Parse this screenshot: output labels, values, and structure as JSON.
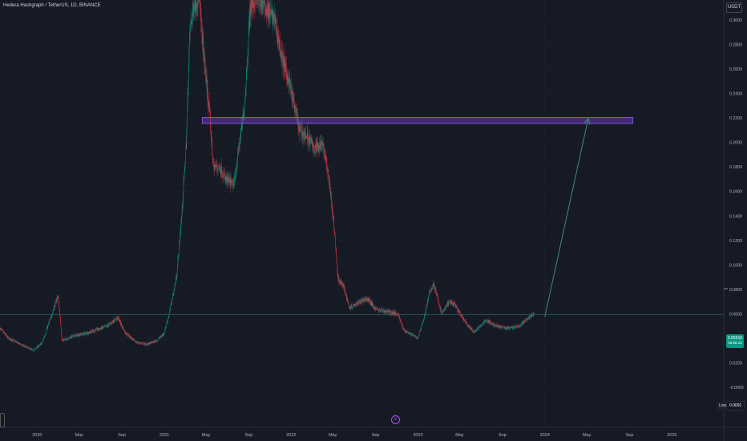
{
  "title": "Hedera Hashgraph / TetherUS, 1D, BINANCE",
  "currency": "USDT",
  "low_label": "Low",
  "low_value": "0.0091",
  "current_price": "0.05916",
  "price_countdown": "05:56:15",
  "colors": {
    "up": "#089981",
    "down": "#f23645",
    "zone": "#673ab7",
    "arrow": "#3f8c6f",
    "background": "#161a25"
  },
  "chart_data": {
    "type": "candlestick",
    "title": "Hedera Hashgraph / TetherUS, 1D, BINANCE",
    "ylabel": "USDT",
    "ylim": [
      -0.004,
      0.306
    ],
    "y_ticks": [
      "0.3000",
      "0.2800",
      "0.2600",
      "0.2400",
      "0.2200",
      "0.2000",
      "0.1800",
      "0.1600",
      "0.1400",
      "0.1200",
      "0.1000",
      "0.0800",
      "0.0600",
      "0.0400",
      "0.0200",
      "-0.0000"
    ],
    "x_ticks": [
      "2020",
      "May",
      "Sep",
      "2021",
      "May",
      "Sep",
      "2022",
      "May",
      "Sep",
      "2023",
      "May",
      "Sep",
      "2024",
      "May",
      "Sep",
      "2025"
    ],
    "x_range": [
      "2019-09-16",
      "2025-08-05"
    ],
    "price_path": [
      [
        "2019-09-16",
        0.048
      ],
      [
        "2019-10-10",
        0.04
      ],
      [
        "2019-11-15",
        0.035
      ],
      [
        "2019-12-20",
        0.03
      ],
      [
        "2020-01-15",
        0.036
      ],
      [
        "2020-02-15",
        0.062
      ],
      [
        "2020-03-01",
        0.075
      ],
      [
        "2020-03-13",
        0.038
      ],
      [
        "2020-04-15",
        0.042
      ],
      [
        "2020-05-20",
        0.044
      ],
      [
        "2020-06-20",
        0.047
      ],
      [
        "2020-07-20",
        0.05
      ],
      [
        "2020-08-20",
        0.057
      ],
      [
        "2020-09-10",
        0.045
      ],
      [
        "2020-10-10",
        0.037
      ],
      [
        "2020-11-10",
        0.035
      ],
      [
        "2020-12-10",
        0.038
      ],
      [
        "2020-12-31",
        0.044
      ],
      [
        "2021-01-15",
        0.06
      ],
      [
        "2021-02-05",
        0.09
      ],
      [
        "2021-02-20",
        0.14
      ],
      [
        "2021-03-05",
        0.2
      ],
      [
        "2021-03-15",
        0.29
      ],
      [
        "2021-03-25",
        0.31
      ],
      [
        "2021-04-10",
        0.32
      ],
      [
        "2021-04-25",
        0.27
      ],
      [
        "2021-05-12",
        0.22
      ],
      [
        "2021-05-22",
        0.18
      ],
      [
        "2021-06-10",
        0.18
      ],
      [
        "2021-06-25",
        0.17
      ],
      [
        "2021-07-20",
        0.165
      ],
      [
        "2021-08-20",
        0.23
      ],
      [
        "2021-09-05",
        0.31
      ],
      [
        "2021-09-25",
        0.32
      ],
      [
        "2021-10-20",
        0.31
      ],
      [
        "2021-11-15",
        0.3
      ],
      [
        "2021-12-05",
        0.27
      ],
      [
        "2021-12-25",
        0.25
      ],
      [
        "2022-01-10",
        0.23
      ],
      [
        "2022-01-25",
        0.21
      ],
      [
        "2022-02-15",
        0.205
      ],
      [
        "2022-03-10",
        0.195
      ],
      [
        "2022-04-01",
        0.2
      ],
      [
        "2022-04-20",
        0.17
      ],
      [
        "2022-05-08",
        0.12
      ],
      [
        "2022-05-15",
        0.09
      ],
      [
        "2022-06-01",
        0.082
      ],
      [
        "2022-06-18",
        0.065
      ],
      [
        "2022-07-15",
        0.07
      ],
      [
        "2022-08-10",
        0.072
      ],
      [
        "2022-09-01",
        0.064
      ],
      [
        "2022-10-01",
        0.062
      ],
      [
        "2022-11-05",
        0.06
      ],
      [
        "2022-11-20",
        0.047
      ],
      [
        "2022-12-15",
        0.043
      ],
      [
        "2022-12-31",
        0.04
      ],
      [
        "2023-01-20",
        0.058
      ],
      [
        "2023-02-01",
        0.075
      ],
      [
        "2023-02-15",
        0.085
      ],
      [
        "2023-03-10",
        0.06
      ],
      [
        "2023-04-01",
        0.07
      ],
      [
        "2023-04-15",
        0.068
      ],
      [
        "2023-05-15",
        0.054
      ],
      [
        "2023-06-10",
        0.045
      ],
      [
        "2023-07-01",
        0.05
      ],
      [
        "2023-07-15",
        0.055
      ],
      [
        "2023-08-15",
        0.05
      ],
      [
        "2023-09-15",
        0.048
      ],
      [
        "2023-10-20",
        0.05
      ],
      [
        "2023-11-20",
        0.058
      ],
      [
        "2023-12-01",
        0.06
      ]
    ],
    "annotations": [
      {
        "kind": "resistance-zone",
        "from": "2021-04-20",
        "to": "2024-09-10",
        "y_low": 0.2155,
        "y_high": 0.2205
      },
      {
        "kind": "target-arrow",
        "from": [
          "2024-01-01",
          0.0575
        ],
        "to": [
          "2024-05-05",
          0.2195
        ]
      }
    ],
    "current_price": 0.05916,
    "grid": true
  }
}
